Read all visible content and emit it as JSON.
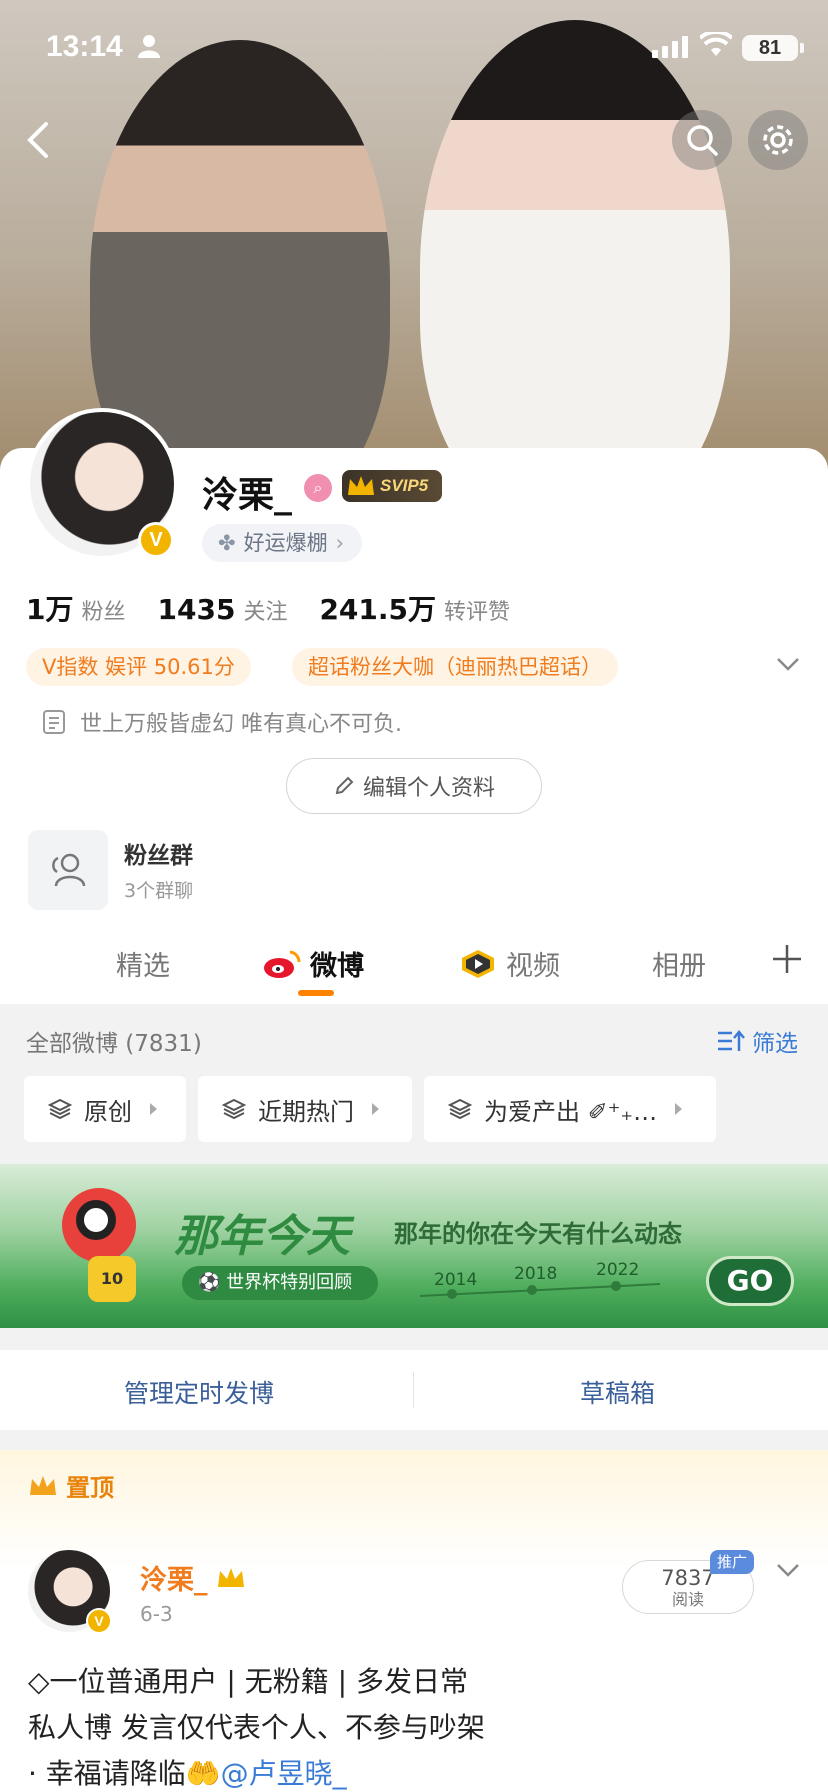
{
  "status_bar": {
    "time": "13:14",
    "battery": "81"
  },
  "profile": {
    "name": "泠栗_",
    "verified_badge": "V",
    "svip_label": "SVIP5",
    "luck_chip": "好运爆棚",
    "stats": [
      {
        "num": "1万",
        "label": "粉丝"
      },
      {
        "num": "1435",
        "label": "关注"
      },
      {
        "num": "241.5万",
        "label": "转评赞"
      }
    ],
    "tags": [
      "V指数 娱评 50.61分",
      "超话粉丝大咖（迪丽热巴超话）"
    ],
    "bio": "世上万般皆虚幻 唯有真心不可负.",
    "edit_button": "编辑个人资料",
    "fan_group": {
      "title": "粉丝群",
      "subtitle": "3个群聊"
    }
  },
  "tabs": [
    {
      "label": "精选",
      "active": false
    },
    {
      "label": "微博",
      "active": true
    },
    {
      "label": "视频",
      "active": false
    },
    {
      "label": "相册",
      "active": false
    }
  ],
  "feed": {
    "all_count": "全部微博 (7831)",
    "filter_label": "筛选",
    "chips": [
      "原创",
      "近期热门",
      "为爱产出 ✐⁺₊…"
    ]
  },
  "banner": {
    "title": "那年今天",
    "slogan": "那年的你在今天有什么动态",
    "pill": "世界杯特别回顾",
    "years": [
      "2014",
      "2018",
      "2022"
    ],
    "go": "GO"
  },
  "actions": {
    "scheduled": "管理定时发博",
    "drafts": "草稿箱"
  },
  "pinned_post": {
    "pin_label": "置顶",
    "author": "泠栗_",
    "date": "6-3",
    "reads_num": "7837",
    "reads_label": "阅读",
    "promo": "推广",
    "lines": [
      "◇一位普通用户 | 无粉籍 | 多发日常",
      "私人博 发言仅代表个人、不参与吵架",
      "· 幸福请降临🤲"
    ],
    "mention": "@卢昱晓_"
  },
  "colors": {
    "accent": "#ff8200",
    "link": "#3a7bd5",
    "tag_text": "#f07c1e"
  },
  "icons": [
    "back-icon",
    "search-icon",
    "gear-icon",
    "person-icon",
    "doc-icon",
    "pencil-icon",
    "group-icon",
    "weibo-icon",
    "video-icon",
    "plus-icon",
    "filter-icon",
    "layers-icon",
    "crown-icon",
    "chevron-down-icon"
  ]
}
